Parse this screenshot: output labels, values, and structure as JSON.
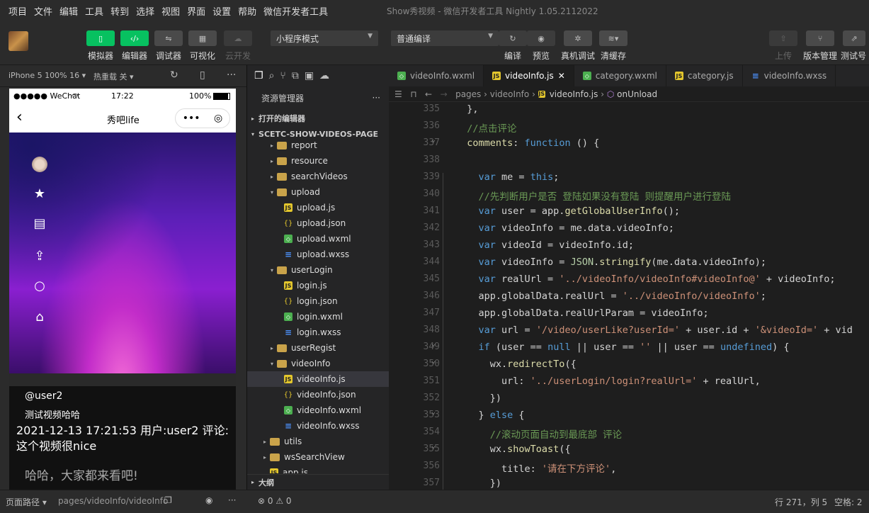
{
  "menubar": {
    "items": [
      "项目",
      "文件",
      "编辑",
      "工具",
      "转到",
      "选择",
      "视图",
      "界面",
      "设置",
      "帮助",
      "微信开发者工具"
    ],
    "window_title": "Show秀视频 - 微信开发者工具 Nightly 1.05.2112022"
  },
  "toolbar": {
    "simulator": "模拟器",
    "editor": "编辑器",
    "debugger": "调试器",
    "visual": "可视化",
    "cloud": "云开发",
    "mode": "小程序模式",
    "compile": "普通编译",
    "compile_btn": "编译",
    "preview": "预览",
    "remote_debug": "真机调试",
    "clear_cache": "清缓存",
    "upload": "上传",
    "version": "版本管理",
    "test": "测试号"
  },
  "sim_header": {
    "device": "iPhone 5 100% 16",
    "hot_reload": "热重载 关"
  },
  "phone": {
    "carrier": "●●●●● WeChat",
    "time": "17:22",
    "battery": "100%",
    "title": "秀吧life",
    "capsule_dots": "•••",
    "username": "@user2",
    "desc": "测试视频哈哈",
    "comment": "2021-12-13 17:21:53 用户:user2 评论:这个视频很nice",
    "danmu": "哈哈，大家都来看吧!"
  },
  "explorer": {
    "title": "资源管理器",
    "open_editors": "打开的编辑器",
    "project": "SCETC-SHOW-VIDEOS-PAGE",
    "outline": "大纲",
    "tree": [
      {
        "label": "report",
        "type": "folder",
        "depth": 1,
        "arrow": "▸"
      },
      {
        "label": "resource",
        "type": "folder",
        "depth": 1,
        "arrow": "▸"
      },
      {
        "label": "searchVideos",
        "type": "folder",
        "depth": 1,
        "arrow": "▸"
      },
      {
        "label": "upload",
        "type": "folder",
        "depth": 1,
        "arrow": "▾"
      },
      {
        "label": "upload.js",
        "type": "js",
        "depth": 2,
        "arrow": ""
      },
      {
        "label": "upload.json",
        "type": "json",
        "depth": 2,
        "arrow": ""
      },
      {
        "label": "upload.wxml",
        "type": "wxml",
        "depth": 2,
        "arrow": ""
      },
      {
        "label": "upload.wxss",
        "type": "wxss",
        "depth": 2,
        "arrow": ""
      },
      {
        "label": "userLogin",
        "type": "folder",
        "depth": 1,
        "arrow": "▾"
      },
      {
        "label": "login.js",
        "type": "js",
        "depth": 2,
        "arrow": ""
      },
      {
        "label": "login.json",
        "type": "json",
        "depth": 2,
        "arrow": ""
      },
      {
        "label": "login.wxml",
        "type": "wxml",
        "depth": 2,
        "arrow": ""
      },
      {
        "label": "login.wxss",
        "type": "wxss",
        "depth": 2,
        "arrow": ""
      },
      {
        "label": "userRegist",
        "type": "folder",
        "depth": 1,
        "arrow": "▸"
      },
      {
        "label": "videoInfo",
        "type": "folder",
        "depth": 1,
        "arrow": "▾"
      },
      {
        "label": "videoInfo.js",
        "type": "js",
        "depth": 2,
        "arrow": "",
        "active": true
      },
      {
        "label": "videoInfo.json",
        "type": "json",
        "depth": 2,
        "arrow": ""
      },
      {
        "label": "videoInfo.wxml",
        "type": "wxml",
        "depth": 2,
        "arrow": ""
      },
      {
        "label": "videoInfo.wxss",
        "type": "wxss",
        "depth": 2,
        "arrow": ""
      },
      {
        "label": "utils",
        "type": "folder",
        "depth": 0,
        "arrow": "▸"
      },
      {
        "label": "wsSearchView",
        "type": "folder",
        "depth": 0,
        "arrow": "▸"
      },
      {
        "label": "app.js",
        "type": "js",
        "depth": 0,
        "arrow": ""
      }
    ]
  },
  "tabs": [
    {
      "label": "videoInfo.wxml",
      "type": "wxml"
    },
    {
      "label": "videoInfo.js",
      "type": "js",
      "active": true
    },
    {
      "label": "category.wxml",
      "type": "wxml"
    },
    {
      "label": "category.js",
      "type": "js"
    },
    {
      "label": "videoInfo.wxss",
      "type": "wxss"
    }
  ],
  "breadcrumb": {
    "p1": "pages",
    "p2": "videoInfo",
    "p3": "videoInfo.js",
    "p4": "onUnload"
  },
  "code": [
    {
      "n": "335",
      "f": "",
      "t": [
        [
          "nm",
          "  },"
        ]
      ]
    },
    {
      "n": "336",
      "f": "",
      "t": [
        [
          "cm",
          "  //点击评论"
        ]
      ]
    },
    {
      "n": "337",
      "f": "⌄",
      "t": [
        [
          "fn",
          "  comments"
        ],
        [
          "nm",
          ": "
        ],
        [
          "kw",
          "function"
        ],
        [
          "nm",
          " () {"
        ]
      ]
    },
    {
      "n": "338",
      "f": "",
      "t": [
        [
          "nm",
          ""
        ]
      ]
    },
    {
      "n": "339",
      "f": "",
      "t": [
        [
          "kw",
          "    var"
        ],
        [
          "nm",
          " me = "
        ],
        [
          "kw",
          "this"
        ],
        [
          "nm",
          ";"
        ]
      ]
    },
    {
      "n": "340",
      "f": "",
      "t": [
        [
          "cm",
          "    //先判断用户是否 登陆如果没有登陆 则提醒用户进行登陆"
        ]
      ]
    },
    {
      "n": "341",
      "f": "",
      "t": [
        [
          "kw",
          "    var"
        ],
        [
          "nm",
          " user = app."
        ],
        [
          "fn",
          "getGlobalUserInfo"
        ],
        [
          "nm",
          "();"
        ]
      ]
    },
    {
      "n": "342",
      "f": "",
      "t": [
        [
          "kw",
          "    var"
        ],
        [
          "nm",
          " videoInfo = me.data.videoInfo;"
        ]
      ]
    },
    {
      "n": "343",
      "f": "",
      "t": [
        [
          "kw",
          "    var"
        ],
        [
          "nm",
          " videoId = videoInfo.id;"
        ]
      ]
    },
    {
      "n": "344",
      "f": "",
      "t": [
        [
          "kw",
          "    var"
        ],
        [
          "nm",
          " videoInfo = "
        ],
        [
          "num",
          "JSON"
        ],
        [
          "nm",
          "."
        ],
        [
          "fn",
          "stringify"
        ],
        [
          "nm",
          "(me.data.videoInfo);"
        ]
      ]
    },
    {
      "n": "345",
      "f": "",
      "t": [
        [
          "kw",
          "    var"
        ],
        [
          "nm",
          " realUrl = "
        ],
        [
          "str",
          "'../videoInfo/videoInfo#videoInfo@'"
        ],
        [
          "nm",
          " + videoInfo;"
        ]
      ]
    },
    {
      "n": "346",
      "f": "",
      "t": [
        [
          "nm",
          "    app.globalData.realUrl = "
        ],
        [
          "str",
          "'../videoInfo/videoInfo'"
        ],
        [
          "nm",
          ";"
        ]
      ]
    },
    {
      "n": "347",
      "f": "",
      "t": [
        [
          "nm",
          "    app.globalData.realUrlParam = videoInfo;"
        ]
      ]
    },
    {
      "n": "348",
      "f": "",
      "t": [
        [
          "kw",
          "    var"
        ],
        [
          "nm",
          " url = "
        ],
        [
          "str",
          "'/video/userLike?userId='"
        ],
        [
          "nm",
          " + user.id + "
        ],
        [
          "str",
          "'&videoId='"
        ],
        [
          "nm",
          " + vid"
        ]
      ]
    },
    {
      "n": "349",
      "f": "⌄",
      "t": [
        [
          "kw",
          "    if"
        ],
        [
          "nm",
          " (user == "
        ],
        [
          "kw",
          "null"
        ],
        [
          "nm",
          " || user == "
        ],
        [
          "str",
          "''"
        ],
        [
          "nm",
          " || user == "
        ],
        [
          "kw",
          "undefined"
        ],
        [
          "nm",
          ") {"
        ]
      ]
    },
    {
      "n": "350",
      "f": "⌄",
      "t": [
        [
          "nm",
          "      wx."
        ],
        [
          "fn",
          "redirectTo"
        ],
        [
          "nm",
          "({"
        ]
      ]
    },
    {
      "n": "351",
      "f": "",
      "t": [
        [
          "nm",
          "        url: "
        ],
        [
          "str",
          "'../userLogin/login?realUrl='"
        ],
        [
          "nm",
          " + realUrl,"
        ]
      ]
    },
    {
      "n": "352",
      "f": "",
      "t": [
        [
          "nm",
          "      })"
        ]
      ]
    },
    {
      "n": "353",
      "f": "⌄",
      "t": [
        [
          "nm",
          "    } "
        ],
        [
          "kw",
          "else"
        ],
        [
          "nm",
          " {"
        ]
      ]
    },
    {
      "n": "354",
      "f": "",
      "t": [
        [
          "cm",
          "      //滚动页面自动到最底部 评论"
        ]
      ]
    },
    {
      "n": "355",
      "f": "⌄",
      "t": [
        [
          "nm",
          "      wx."
        ],
        [
          "fn",
          "showToast"
        ],
        [
          "nm",
          "({"
        ]
      ]
    },
    {
      "n": "356",
      "f": "",
      "t": [
        [
          "nm",
          "        title: "
        ],
        [
          "str",
          "'请在下方评论'"
        ],
        [
          "nm",
          ","
        ]
      ]
    },
    {
      "n": "357",
      "f": "",
      "t": [
        [
          "nm",
          "      })"
        ]
      ]
    }
  ],
  "statusbar": {
    "page_path_label": "页面路径",
    "page_path": "pages/videoInfo/videoInfo",
    "problems": "⊗ 0 ⚠ 0",
    "position": "行 271，列 5",
    "spaces": "空格: 2"
  },
  "colors": {
    "accent": "#07c160",
    "bg": "#1e1e1e"
  }
}
